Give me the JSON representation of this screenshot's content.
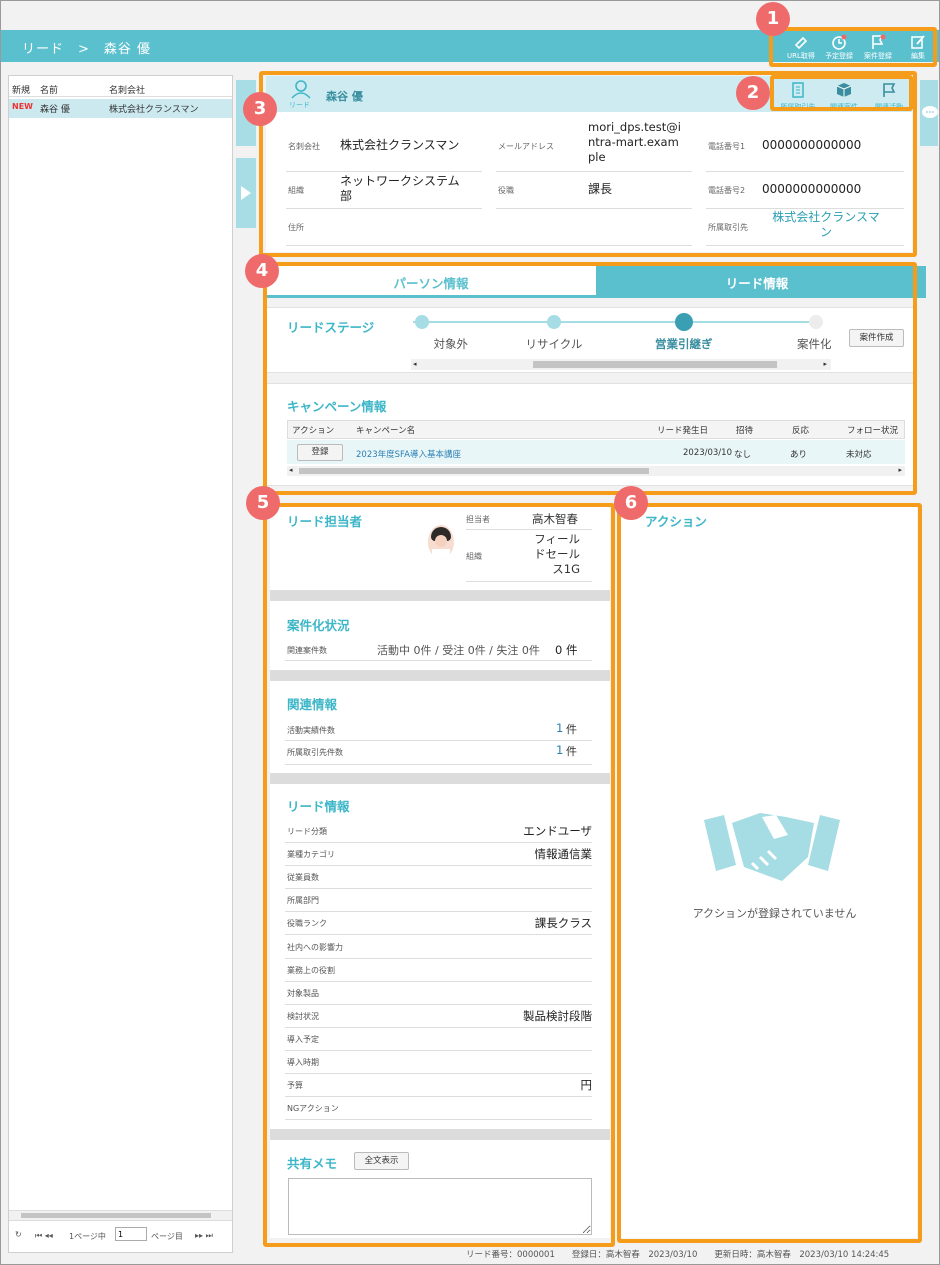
{
  "header": {
    "breadcrumb": "リード　>　森谷 優",
    "toolbar": [
      {
        "label": "URL取得",
        "icon": "link-icon"
      },
      {
        "label": "予定登録",
        "icon": "clock-icon"
      },
      {
        "label": "案件登録",
        "icon": "flag-icon"
      },
      {
        "label": "編集",
        "icon": "edit-icon"
      }
    ]
  },
  "markers": [
    "1",
    "2",
    "3",
    "4",
    "5",
    "6"
  ],
  "list": {
    "headers": [
      "新規",
      "名前",
      "名刺会社"
    ],
    "rows": [
      {
        "badge": "NEW",
        "name": "森谷 優",
        "company": "株式会社クランスマン"
      }
    ],
    "pager": {
      "prefix": "1ページ中",
      "page": "1",
      "suffix": "ページ目"
    }
  },
  "profile": {
    "user_icon_label": "リード",
    "name": "森谷 優",
    "actions": [
      {
        "label": "所属取引先",
        "icon": "building-icon"
      },
      {
        "label": "関連案件",
        "icon": "box-icon"
      },
      {
        "label": "関連活動",
        "icon": "flag-icon"
      }
    ],
    "fields": [
      {
        "label": "名刺会社",
        "value": "株式会社クランスマン"
      },
      {
        "label": "メールアドレス",
        "value": "mori_dps.test@intra-mart.example"
      },
      {
        "label": "電話番号1",
        "value": "0000000000000"
      },
      {
        "label": "組織",
        "value": "ネットワークシステム部"
      },
      {
        "label": "役職",
        "value": "課長"
      },
      {
        "label": "電話番号2",
        "value": "0000000000000"
      },
      {
        "label": "住所",
        "value": ""
      },
      {
        "label": "所属取引先",
        "value": "株式会社クランスマン"
      }
    ]
  },
  "tabs": {
    "person": "パーソン情報",
    "lead": "リード情報"
  },
  "stage": {
    "title": "リードステージ",
    "steps": [
      "対象外",
      "リサイクル",
      "営業引継ぎ",
      "案件化"
    ],
    "current_index": 2,
    "button": "案件作成"
  },
  "campaign": {
    "title": "キャンペーン情報",
    "columns": [
      "アクション",
      "キャンペーン名",
      "リード発生日",
      "招待",
      "反応",
      "フォロー状況"
    ],
    "rows": [
      {
        "action": "登録",
        "name": "2023年度SFA導入基本講座",
        "date": "2023/03/10",
        "invite": "なし",
        "reaction": "あり",
        "follow": "未対応"
      }
    ]
  },
  "owner": {
    "title": "リード担当者",
    "fields": [
      {
        "label": "担当者",
        "value": "高木智春"
      },
      {
        "label": "組織",
        "value": "フィールドセールス1G"
      }
    ]
  },
  "deal": {
    "title": "案件化状況",
    "label": "関連案件数",
    "detail": "活動中 0件 / 受注 0件 / 失注 0件",
    "count": "0 件"
  },
  "related": {
    "title": "関連情報",
    "rows": [
      {
        "label": "活動実績件数",
        "count": "1",
        "unit": "件"
      },
      {
        "label": "所属取引先件数",
        "count": "1",
        "unit": "件"
      }
    ]
  },
  "leadinfo": {
    "title": "リード情報",
    "rows": [
      {
        "label": "リード分類",
        "value": "エンドユーザ"
      },
      {
        "label": "業種カテゴリ",
        "value": "情報通信業"
      },
      {
        "label": "従業員数",
        "value": ""
      },
      {
        "label": "所属部門",
        "value": ""
      },
      {
        "label": "役職ランク",
        "value": "課長クラス"
      },
      {
        "label": "社内への影響力",
        "value": ""
      },
      {
        "label": "業務上の役割",
        "value": ""
      },
      {
        "label": "対象製品",
        "value": ""
      },
      {
        "label": "検討状況",
        "value": "製品検討段階"
      },
      {
        "label": "導入予定",
        "value": ""
      },
      {
        "label": "導入時期",
        "value": ""
      },
      {
        "label": "予算",
        "value": "円"
      },
      {
        "label": "NGアクション",
        "value": ""
      }
    ]
  },
  "memo": {
    "title": "共有メモ",
    "button": "全文表示"
  },
  "action": {
    "title": "アクション",
    "empty": "アクションが登録されていません"
  },
  "footer": {
    "text": "リード番号：0000001　　登録日：高木智春　2023/03/10　　更新日時：高木智春　2023/03/10 14:24:45"
  },
  "colors": {
    "teal": "#5bc0ce",
    "accent": "#3db6c8",
    "orange": "#f59c1a",
    "marker": "#ef6b6b"
  }
}
